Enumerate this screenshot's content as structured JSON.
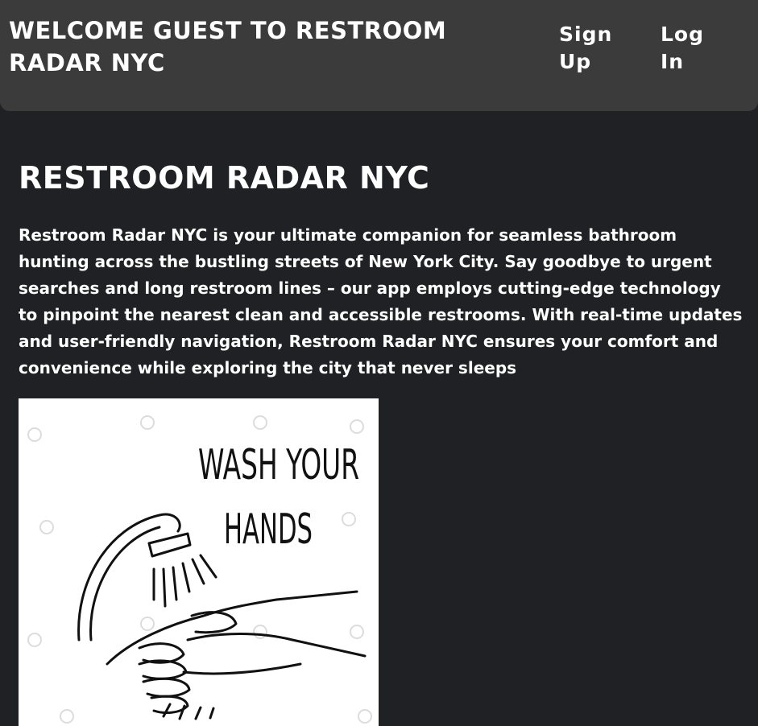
{
  "header": {
    "welcome": "WELCOME GUEST TO RESTROOM RADAR NYC",
    "nav": {
      "signup": "Sign Up",
      "login": "Log In"
    }
  },
  "main": {
    "title": "RESTROOM RADAR NYC",
    "description": "Restroom Radar NYC is your ultimate companion for seamless bathroom hunting across the bustling streets of New York City. Say goodbye to urgent searches and long restroom lines – our app employs cutting-edge technology to pinpoint the nearest clean and accessible restrooms. With real-time updates and user-friendly navigation, Restroom Radar NYC ensures your comfort and convenience while exploring the city that never sleeps",
    "hero_image": {
      "line1": "WASH YOUR",
      "line2": "HANDS"
    }
  },
  "colors": {
    "background": "#202124",
    "header": "#3b3b3b",
    "text": "#ffffff"
  },
  "icons": [
    "hand-washing-illustration",
    "faucet-icon"
  ]
}
